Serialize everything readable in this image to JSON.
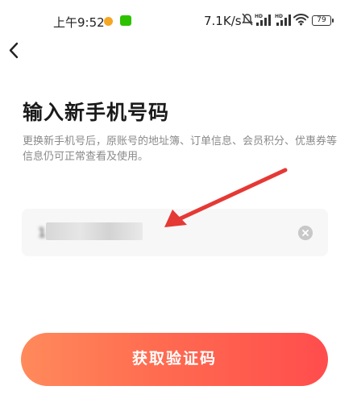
{
  "status_bar": {
    "time": "上午9:52",
    "net_speed": "7.1K/s",
    "sim1_label": "HD",
    "sim2_label": "HD",
    "battery": "79",
    "icons": [
      "chat-notification-icon",
      "wechat-icon",
      "mute-icon",
      "signal-icon",
      "signal-icon",
      "wifi-icon",
      "battery-icon"
    ]
  },
  "nav": {
    "back_icon": "chevron-left-icon"
  },
  "page": {
    "title": "输入新手机号码",
    "description": "更换新手机号后，原账号的地址簿、订单信息、会员积分、优惠券等信息仍可正常查看及使用。"
  },
  "phone_input": {
    "value": "1",
    "masked": true,
    "clear_icon": "clear-icon"
  },
  "annotation": {
    "color": "#e53935",
    "icon": "arrow-pointer-icon"
  },
  "primary_button": {
    "label": "获取验证码",
    "gradient_start": "#ff8a5b",
    "gradient_end": "#ff4d4d"
  }
}
